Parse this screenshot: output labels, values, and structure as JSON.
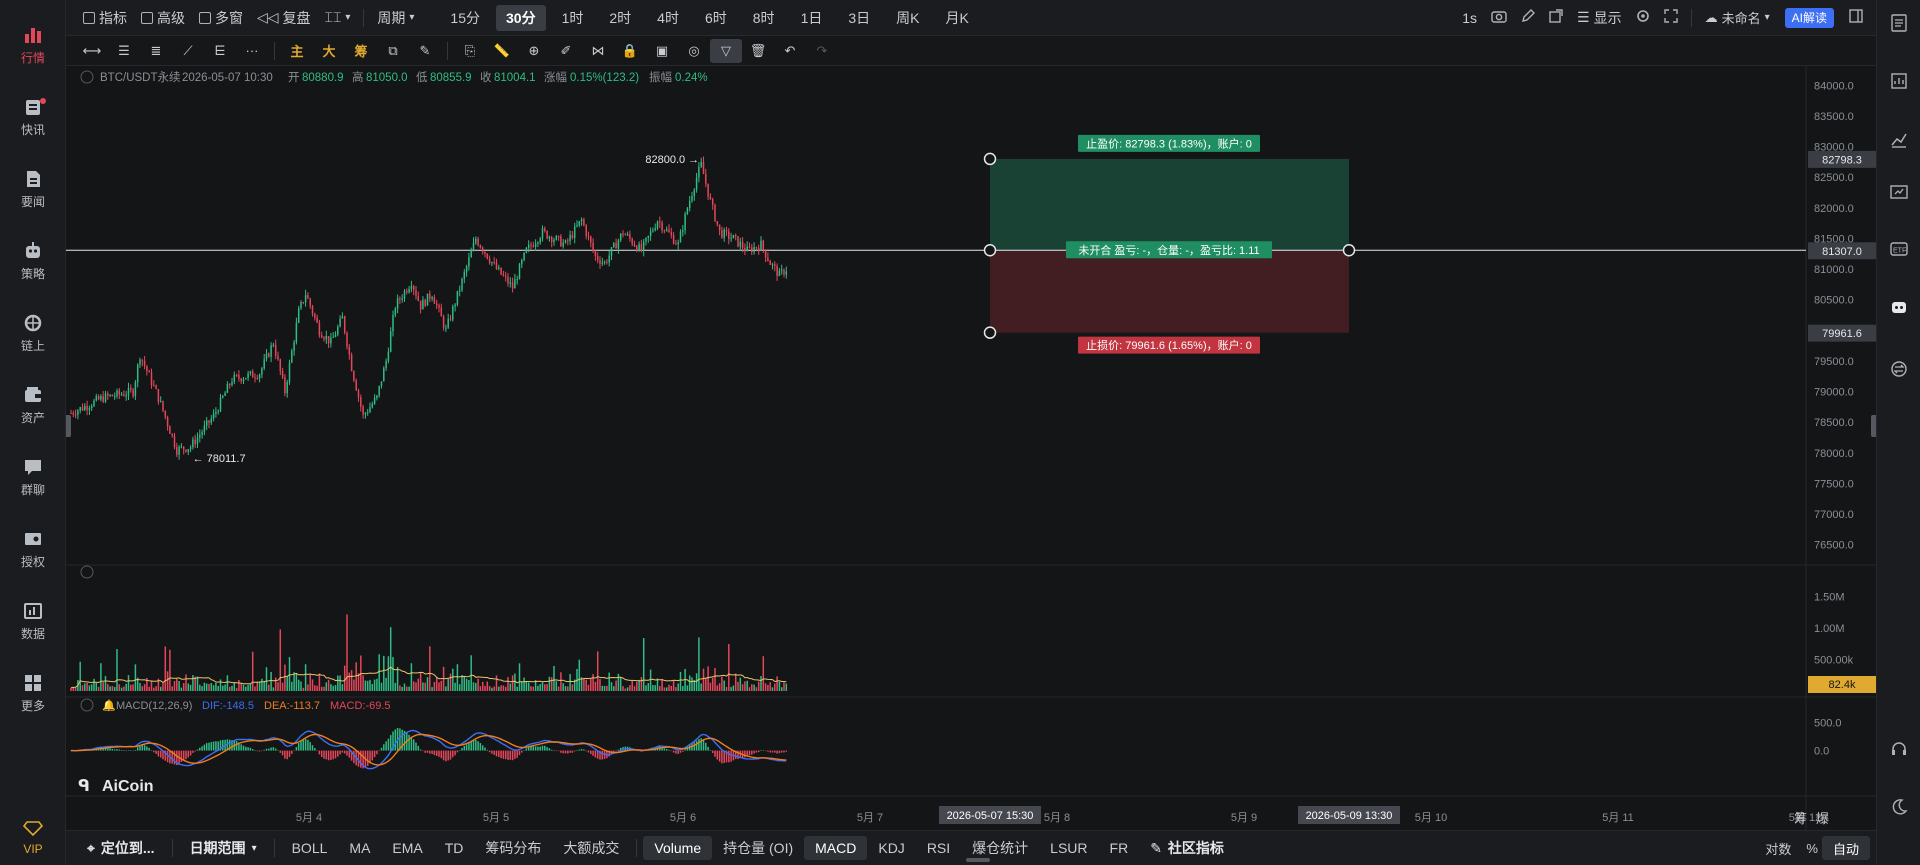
{
  "sidebar": {
    "items": [
      {
        "label": "行情",
        "icon": "bar-chart-icon",
        "active": true
      },
      {
        "label": "快讯",
        "icon": "news-flash-icon",
        "badge": true
      },
      {
        "label": "要闻",
        "icon": "document-icon"
      },
      {
        "label": "策略",
        "icon": "robot-icon"
      },
      {
        "label": "链上",
        "icon": "chain-icon"
      },
      {
        "label": "资产",
        "icon": "wallet-icon"
      },
      {
        "label": "群聊",
        "icon": "chat-icon"
      },
      {
        "label": "授权",
        "icon": "license-icon"
      },
      {
        "label": "数据",
        "icon": "data-icon"
      },
      {
        "label": "更多",
        "icon": "grid-icon"
      },
      {
        "label": "VIP",
        "icon": "diamond-icon"
      }
    ]
  },
  "toolbar": {
    "indicator": "指标",
    "advanced": "高级",
    "multi_window": "多窗",
    "replay": "复盘",
    "period": "周期",
    "timeframes": [
      "15分",
      "30分",
      "1时",
      "2时",
      "4时",
      "6时",
      "8时",
      "1日",
      "3日",
      "周K",
      "月K"
    ],
    "active_timeframe": "30分",
    "interval_1s": "1s",
    "display": "显示",
    "unnamed": "未命名",
    "ai": "AI解读"
  },
  "draw_tools": {
    "zhu": "主",
    "da": "大",
    "chou": "筹"
  },
  "info_line": {
    "symbol": "BTC/USDT永续",
    "time": "2026-05-07 10:30",
    "open_label": "开",
    "open": "80880.9",
    "high_label": "高",
    "high": "81050.0",
    "low_label": "低",
    "low": "80855.9",
    "close_label": "收",
    "close": "81004.1",
    "change_label": "涨幅",
    "change": "0.15%(123.2)",
    "amp_label": "振幅",
    "amp": "0.24%"
  },
  "colors": {
    "up": "#2ebd85",
    "down": "#e5475a",
    "ma": "#e8c56b",
    "dif": "#3d6ff5",
    "dea": "#f07d1e"
  },
  "chart_data": {
    "type": "candlestick",
    "price_axis": {
      "min": 76250,
      "max": 84250,
      "ticks": [
        84000.0,
        83500.0,
        83000.0,
        82500.0,
        82000.0,
        81500.0,
        81000.0,
        80500.0,
        80000.0,
        79500.0,
        79000.0,
        78500.0,
        78000.0,
        77500.0,
        77000.0,
        76500.0
      ]
    },
    "x_ticks": [
      "5月 4",
      "5月 5",
      "5月 6",
      "5月 7",
      "5月 8",
      "5月 9",
      "5月 10",
      "5月 11",
      "5月 12"
    ],
    "anchors": [
      {
        "x": 0,
        "y": 78650
      },
      {
        "x": 14,
        "y": 78900
      },
      {
        "x": 27,
        "y": 79000
      },
      {
        "x": 30,
        "y": 79600
      },
      {
        "x": 38,
        "y": 78900
      },
      {
        "x": 46,
        "y": 78050
      },
      {
        "x": 52,
        "y": 78100
      },
      {
        "x": 62,
        "y": 78600
      },
      {
        "x": 70,
        "y": 79200
      },
      {
        "x": 82,
        "y": 79300
      },
      {
        "x": 88,
        "y": 79800
      },
      {
        "x": 93,
        "y": 79000
      },
      {
        "x": 99,
        "y": 80300
      },
      {
        "x": 102,
        "y": 80600
      },
      {
        "x": 108,
        "y": 80000
      },
      {
        "x": 113,
        "y": 79800
      },
      {
        "x": 118,
        "y": 80200
      },
      {
        "x": 122,
        "y": 79400
      },
      {
        "x": 127,
        "y": 78600
      },
      {
        "x": 133,
        "y": 78900
      },
      {
        "x": 137,
        "y": 79500
      },
      {
        "x": 141,
        "y": 80400
      },
      {
        "x": 148,
        "y": 80800
      },
      {
        "x": 152,
        "y": 80400
      },
      {
        "x": 157,
        "y": 80600
      },
      {
        "x": 163,
        "y": 80000
      },
      {
        "x": 170,
        "y": 80800
      },
      {
        "x": 176,
        "y": 81500
      },
      {
        "x": 185,
        "y": 81000
      },
      {
        "x": 192,
        "y": 80700
      },
      {
        "x": 198,
        "y": 81300
      },
      {
        "x": 205,
        "y": 81600
      },
      {
        "x": 215,
        "y": 81400
      },
      {
        "x": 222,
        "y": 81800
      },
      {
        "x": 228,
        "y": 81200
      },
      {
        "x": 232,
        "y": 81100
      },
      {
        "x": 240,
        "y": 81600
      },
      {
        "x": 248,
        "y": 81300
      },
      {
        "x": 255,
        "y": 81800
      },
      {
        "x": 264,
        "y": 81400
      },
      {
        "x": 268,
        "y": 82000
      },
      {
        "x": 272,
        "y": 82500
      },
      {
        "x": 274,
        "y": 82700
      },
      {
        "x": 278,
        "y": 82100
      },
      {
        "x": 282,
        "y": 81600
      },
      {
        "x": 288,
        "y": 81500
      },
      {
        "x": 294,
        "y": 81300
      },
      {
        "x": 300,
        "y": 81400
      },
      {
        "x": 304,
        "y": 81100
      },
      {
        "x": 308,
        "y": 80900
      },
      {
        "x": 311,
        "y": 81000
      }
    ],
    "labels": {
      "high": "82800.0",
      "low": "78011.7"
    },
    "position": {
      "entry": 81307.0,
      "take_profit": 82798.3,
      "stop_loss": 79961.6,
      "entry_label": "81307.0",
      "tp_label": "82798.3",
      "sl_label": "79961.6",
      "tp_text": "止盈价: 82798.3 (1.83%)，账户: 0",
      "mid_text": "未开合 盈亏: -，仓量: -，盈亏比: 1.11",
      "sl_text": "止损价: 79961.6 (1.65%)，账户: 0",
      "start_label": "2026-05-07 15:30",
      "end_label": "2026-05-09 13:30"
    },
    "volume_axis": {
      "ticks": [
        "1.50M",
        "1.00M",
        "500.00k"
      ],
      "current": "82.4k"
    },
    "macd": {
      "title": "MACD(12,26,9)",
      "dif": "DIF:-148.5",
      "dea": "DEA:-113.7",
      "macd": "MACD:-69.5",
      "ticks": [
        "500.0",
        "0.0"
      ]
    }
  },
  "logo": {
    "text": "AiCoin"
  },
  "bottom": {
    "locate": "定位到...",
    "date_range": "日期范围",
    "indicators": [
      "BOLL",
      "MA",
      "EMA",
      "TD",
      "筹码分布",
      "大额成交"
    ],
    "sub_indicators": [
      "Volume",
      "持仓量 (OI)",
      "MACD",
      "KDJ",
      "RSI",
      "爆仓统计",
      "LSUR",
      "FR"
    ],
    "community": "社区指标",
    "log": "对数",
    "percent": "%",
    "auto": "自动",
    "chou": "筹",
    "bao": "爆"
  }
}
